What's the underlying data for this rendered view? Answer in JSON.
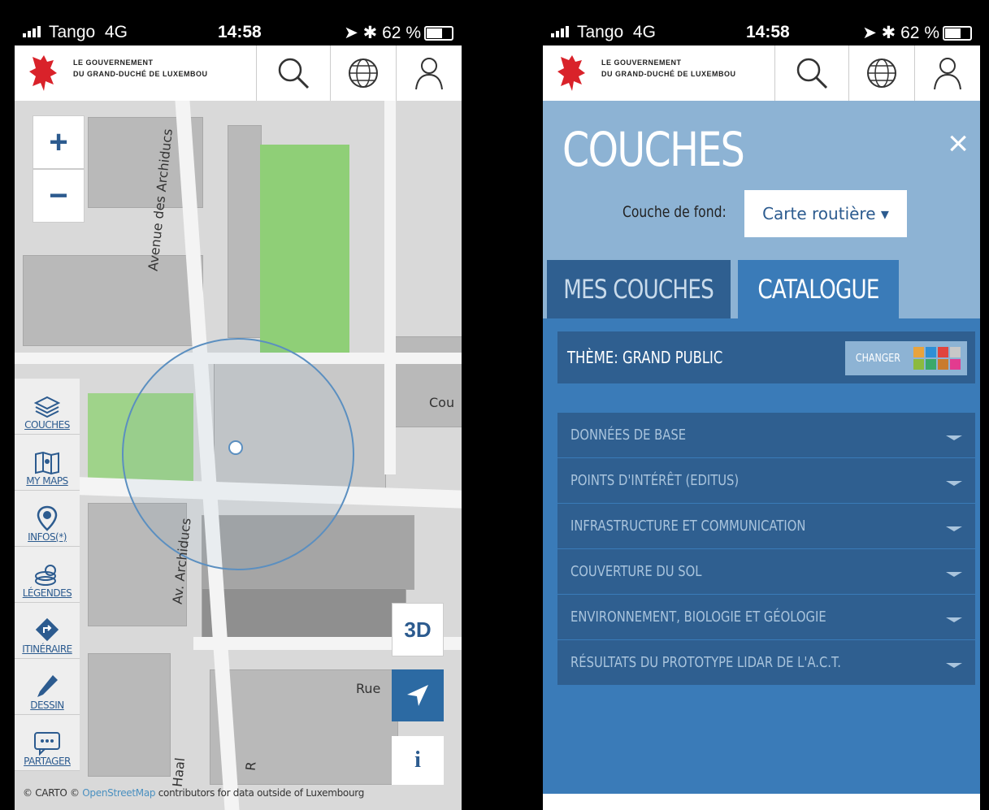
{
  "status_bar": {
    "carrier": "Tango",
    "network": "4G",
    "time": "14:58",
    "battery": "62 %"
  },
  "header": {
    "gov_line1": "LE GOUVERNEMENT",
    "gov_line2": "DU GRAND-DUCHÉ DE LUXEMBOU"
  },
  "map": {
    "zoom_in": "+",
    "zoom_out": "−",
    "street_labels": [
      "Avenue des Archiducs",
      "Av. Archiducs",
      "Rue",
      "Cou",
      "Haal",
      "R"
    ],
    "btn_3d": "3D",
    "btn_info": "i",
    "attribution_prefix": "© CARTO © ",
    "attribution_link": "OpenStreetMap",
    "attribution_suffix": " contributors for data outside of Luxembourg"
  },
  "sidebar": {
    "items": [
      {
        "label": "COUCHES",
        "icon": "layers-icon"
      },
      {
        "label": "MY MAPS",
        "icon": "map-icon"
      },
      {
        "label": "INFOS(*)",
        "icon": "info-pin-icon"
      },
      {
        "label": "LÉGENDES",
        "icon": "legend-icon"
      },
      {
        "label": "ITINÉRAIRE",
        "icon": "route-icon"
      },
      {
        "label": "DESSIN",
        "icon": "pencil-icon"
      },
      {
        "label": "PARTAGER",
        "icon": "share-icon"
      }
    ]
  },
  "panel": {
    "title": "COUCHES",
    "close": "×",
    "fond_label": "Couche de fond:",
    "fond_value": "Carte routière ▾",
    "tabs": [
      {
        "label": "MES COUCHES"
      },
      {
        "label": "CATALOGUE"
      }
    ],
    "theme_label": "THÈME: GRAND PUBLIC",
    "theme_button": "CHANGER",
    "theme_colors": [
      "#e8a33d",
      "#2f8fd6",
      "#e0443e",
      "#c8c8c8",
      "#8cba3f",
      "#3aa86a",
      "#c97b2d",
      "#e23b8f"
    ],
    "categories": [
      "DONNÉES DE BASE",
      "POINTS D'INTÉRÊT (EDITUS)",
      "INFRASTRUCTURE ET COMMUNICATION",
      "COUVERTURE DU SOL",
      "ENVIRONNEMENT, BIOLOGIE ET GÉOLOGIE",
      "RÉSULTATS DU PROTOTYPE LIDAR DE L'A.C.T."
    ]
  },
  "colors": {
    "brand_blue": "#2c5b8f",
    "panel_blue": "#3a7bb8",
    "panel_light": "#8db3d4",
    "logo_red": "#d9222a"
  }
}
